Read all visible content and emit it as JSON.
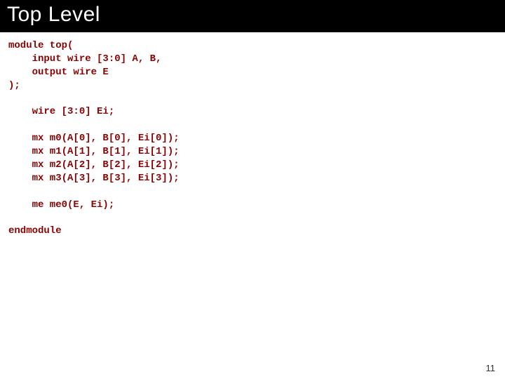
{
  "title": "Top Level",
  "code": "module top(\n    input wire [3:0] A, B,\n    output wire E\n);\n\n    wire [3:0] Ei;\n\n    mx m0(A[0], B[0], Ei[0]);\n    mx m1(A[1], B[1], Ei[1]);\n    mx m2(A[2], B[2], Ei[2]);\n    mx m3(A[3], B[3], Ei[3]);\n\n    me me0(E, Ei);\n\nendmodule",
  "page_number": "11"
}
